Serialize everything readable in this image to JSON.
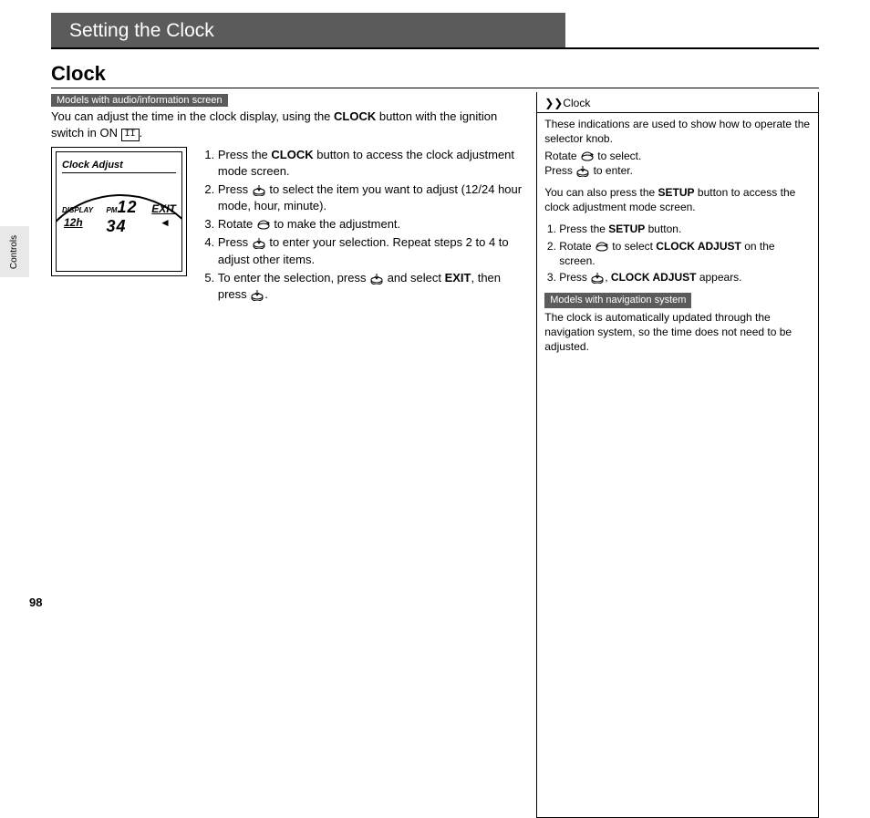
{
  "header": {
    "title": "Setting the Clock"
  },
  "section": {
    "title": "Clock"
  },
  "badge_left": "Models with audio/information screen",
  "intro": {
    "line1a": "You can adjust the time in the clock display, using the ",
    "line1b": "CLOCK",
    "line1c": " button with the ignition switch in ON ",
    "on_sym": "II",
    "line1d": "."
  },
  "screen": {
    "title": "Clock Adjust",
    "display": "DISPLAY",
    "h12": "12h",
    "pm": "PM",
    "time": "12 34",
    "exit": "EXIT"
  },
  "steps": {
    "s1a": "Press the ",
    "s1b": "CLOCK",
    "s1c": " button to access the clock adjustment mode screen.",
    "s2a": "Press ",
    "s2b": " to select the item you want to adjust (12/24 hour mode, hour, minute).",
    "s3a": "Rotate ",
    "s3b": " to make the adjustment.",
    "s4a": "Press ",
    "s4b": " to enter your selection. Repeat steps 2 to 4 to adjust other items.",
    "s5a": "To enter the selection, press ",
    "s5b": " and select ",
    "s5c": "EXIT",
    "s5d": ", then press ",
    "s5e": "."
  },
  "sidebar": {
    "head_icon": "❯❯",
    "head": "Clock",
    "p1": "These indications are used to show how to operate the selector knob.",
    "rot_a": "Rotate ",
    "rot_b": " to select.",
    "prs_a": "Press ",
    "prs_b": " to enter.",
    "p2a": "You can also press the ",
    "p2b": "SETUP",
    "p2c": " button to access the clock adjustment mode screen.",
    "o1a": "Press the ",
    "o1b": "SETUP",
    "o1c": " button.",
    "o2a": "Rotate ",
    "o2b": " to select ",
    "o2c": "CLOCK ADJUST",
    "o2d": " on the screen.",
    "o3a": "Press ",
    "o3b": ", ",
    "o3c": "CLOCK ADJUST",
    "o3d": " appears.",
    "badge_nav": "Models with navigation system",
    "nav_text": "The clock is automatically updated through the navigation system, so the time does not need to be adjusted."
  },
  "tab_label": "Controls",
  "page_number": "98"
}
